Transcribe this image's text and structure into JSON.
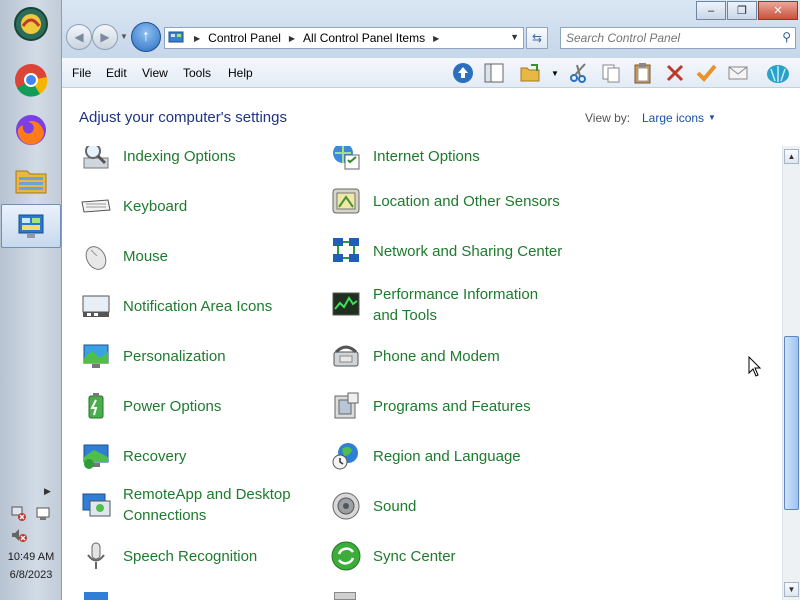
{
  "taskbar": {
    "apps": [
      {
        "name": "shell-orb-icon"
      },
      {
        "name": "chrome-icon"
      },
      {
        "name": "firefox-icon"
      },
      {
        "name": "file-explorer-icon"
      },
      {
        "name": "control-panel-taskbar-icon",
        "active": true
      }
    ],
    "clock": {
      "time": "10:49 AM",
      "date": "6/8/2023"
    }
  },
  "window": {
    "caption_buttons": {
      "minimize": "–",
      "maximize": "❐",
      "close": "✕"
    },
    "address": {
      "segments": [
        "Control Panel",
        "All Control Panel Items"
      ]
    },
    "search": {
      "placeholder": "Search Control Panel"
    },
    "menu": [
      "File",
      "Edit",
      "View",
      "Tools",
      "Help"
    ],
    "toolbar_icons": [
      "up-icon",
      "pane-icon",
      "folder-icon",
      "cut-icon",
      "copy-icon",
      "paste-icon",
      "delete-icon",
      "check-icon",
      "mail-icon",
      "shell-icon"
    ]
  },
  "header": {
    "title": "Adjust your computer's settings",
    "view_by_label": "View by:",
    "view_by_value": "Large icons"
  },
  "items": [
    {
      "label": "Indexing Options",
      "icon": "indexing-icon"
    },
    {
      "label": "Internet Options",
      "icon": "internet-options-icon"
    },
    {
      "label": "Keyboard",
      "icon": "keyboard-icon"
    },
    {
      "label": "Location and Other Sensors",
      "icon": "location-sensors-icon"
    },
    {
      "label": "Mouse",
      "icon": "mouse-icon"
    },
    {
      "label": "Network and Sharing Center",
      "icon": "network-icon"
    },
    {
      "label": "Notification Area Icons",
      "icon": "notification-area-icon"
    },
    {
      "label": "Performance Information and Tools",
      "icon": "performance-icon"
    },
    {
      "label": "Personalization",
      "icon": "personalization-icon"
    },
    {
      "label": "Phone and Modem",
      "icon": "phone-modem-icon"
    },
    {
      "label": "Power Options",
      "icon": "power-icon"
    },
    {
      "label": "Programs and Features",
      "icon": "programs-icon"
    },
    {
      "label": "Recovery",
      "icon": "recovery-icon"
    },
    {
      "label": "Region and Language",
      "icon": "region-icon"
    },
    {
      "label": "RemoteApp and Desktop Connections",
      "icon": "remoteapp-icon"
    },
    {
      "label": "Sound",
      "icon": "sound-icon"
    },
    {
      "label": "Speech Recognition",
      "icon": "speech-icon"
    },
    {
      "label": "Sync Center",
      "icon": "sync-icon"
    }
  ],
  "colors": {
    "item_text": "#1e7a2e",
    "header_title": "#1e3287",
    "link": "#1a4fb3"
  }
}
